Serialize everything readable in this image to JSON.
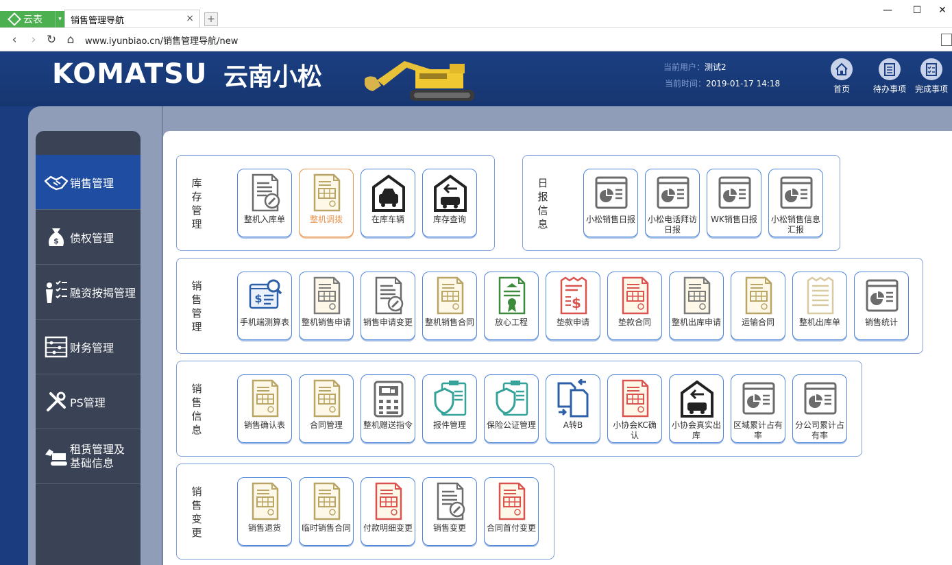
{
  "browser": {
    "brand_label": "云表",
    "tab_title": "销售管理导航",
    "url": "www.iyunbiao.cn/销售管理导航/new"
  },
  "header": {
    "brand": "KOMATSU",
    "company": "云南小松",
    "current_user_label": "当前用户：",
    "current_user": "测试2",
    "current_time_label": "当前时间：",
    "current_time": "2019-01-17 14:18",
    "buttons": [
      {
        "label": "首页",
        "icon": "home-icon"
      },
      {
        "label": "待办事项",
        "icon": "todo-list-icon"
      },
      {
        "label": "完成事项",
        "icon": "done-list-icon"
      }
    ]
  },
  "sidebar": {
    "items": [
      {
        "label": "销售管理",
        "icon": "handshake-icon",
        "active": true
      },
      {
        "label": "债权管理",
        "icon": "money-bag-icon",
        "active": false
      },
      {
        "label": "融资按揭管理",
        "icon": "person-checklist-icon",
        "active": false
      },
      {
        "label": "财务管理",
        "icon": "abacus-icon",
        "active": false
      },
      {
        "label": "PS管理",
        "icon": "tools-icon",
        "active": false
      },
      {
        "label": "租赁管理及\n基础信息",
        "icon": "excavator-icon",
        "active": false
      }
    ]
  },
  "groups": [
    {
      "title": "库存管理",
      "tiles": [
        {
          "label": "整机入库单",
          "icon": "doc-edit-icon",
          "color": "#6b6b6b"
        },
        {
          "label": "整机调拨",
          "icon": "doc-table-icon",
          "color": "#b9a566",
          "selected": true
        },
        {
          "label": "在库车辆",
          "icon": "garage-car-icon",
          "color": "#222222"
        },
        {
          "label": "库存查询",
          "icon": "garage-arrow-icon",
          "color": "#222222"
        }
      ]
    },
    {
      "title": "日报信息",
      "tiles": [
        {
          "label": "小松销售日报",
          "icon": "report-window-icon",
          "color": "#6b6b6b"
        },
        {
          "label": "小松电话拜访日报",
          "icon": "report-window-icon",
          "color": "#6b6b6b"
        },
        {
          "label": "WK销售日报",
          "icon": "report-window-icon",
          "color": "#6b6b6b"
        },
        {
          "label": "小松销售信息汇报",
          "icon": "report-window-icon",
          "color": "#6b6b6b"
        }
      ]
    },
    {
      "title": "销售管理",
      "tiles": [
        {
          "label": "手机端测算表",
          "icon": "mobile-calc-icon",
          "color": "#2d5fa8"
        },
        {
          "label": "整机销售申请",
          "icon": "doc-table-icon",
          "color": "#7a7a7a"
        },
        {
          "label": "销售申请变更",
          "icon": "doc-edit-icon",
          "color": "#6b6b6b"
        },
        {
          "label": "整机销售合同",
          "icon": "doc-table-icon",
          "color": "#b9a566"
        },
        {
          "label": "放心工程",
          "icon": "certificate-icon",
          "color": "#3c8a3c"
        },
        {
          "label": "垫款申请",
          "icon": "receipt-dollar-icon",
          "color": "#d9534f"
        },
        {
          "label": "垫款合同",
          "icon": "doc-table-icon",
          "color": "#d9534f"
        },
        {
          "label": "整机出库申请",
          "icon": "doc-table-icon",
          "color": "#7a7a7a"
        },
        {
          "label": "运输合同",
          "icon": "doc-table-icon",
          "color": "#b9a566"
        },
        {
          "label": "整机出库单",
          "icon": "receipt-icon",
          "color": "#d8c9a0"
        },
        {
          "label": "销售统计",
          "icon": "report-window-icon",
          "color": "#6b6b6b"
        }
      ]
    },
    {
      "title": "销售信息",
      "tiles": [
        {
          "label": "销售确认表",
          "icon": "doc-table-icon",
          "color": "#b9a566"
        },
        {
          "label": "合同管理",
          "icon": "doc-table-icon",
          "color": "#b9a566"
        },
        {
          "label": "整机赠送指令",
          "icon": "calculator-truck-icon",
          "color": "#6b6b6b"
        },
        {
          "label": "报件管理",
          "icon": "shield-clipboard-icon",
          "color": "#36a39a"
        },
        {
          "label": "保险公证管理",
          "icon": "shield-clipboard-icon",
          "color": "#36a39a"
        },
        {
          "label": "A转B",
          "icon": "doc-transfer-icon",
          "color": "#2d5fa8"
        },
        {
          "label": "小协会KC确认",
          "icon": "doc-table-icon",
          "color": "#d9534f"
        },
        {
          "label": "小协会真实出库",
          "icon": "garage-arrow-icon",
          "color": "#222222"
        },
        {
          "label": "区域累计占有率",
          "icon": "report-window-icon",
          "color": "#6b6b6b"
        },
        {
          "label": "分公司累计占有率",
          "icon": "report-window-icon",
          "color": "#6b6b6b"
        }
      ]
    },
    {
      "title": "销售变更",
      "tiles": [
        {
          "label": "销售退货",
          "icon": "doc-table-icon",
          "color": "#b9a566"
        },
        {
          "label": "临时销售合同",
          "icon": "doc-table-icon",
          "color": "#b9a566"
        },
        {
          "label": "付款明细变更",
          "icon": "doc-table-icon",
          "color": "#d9534f"
        },
        {
          "label": "销售变更",
          "icon": "doc-edit-icon",
          "color": "#6b6b6b"
        },
        {
          "label": "合同首付变更",
          "icon": "doc-table-icon",
          "color": "#d9534f"
        }
      ]
    }
  ]
}
